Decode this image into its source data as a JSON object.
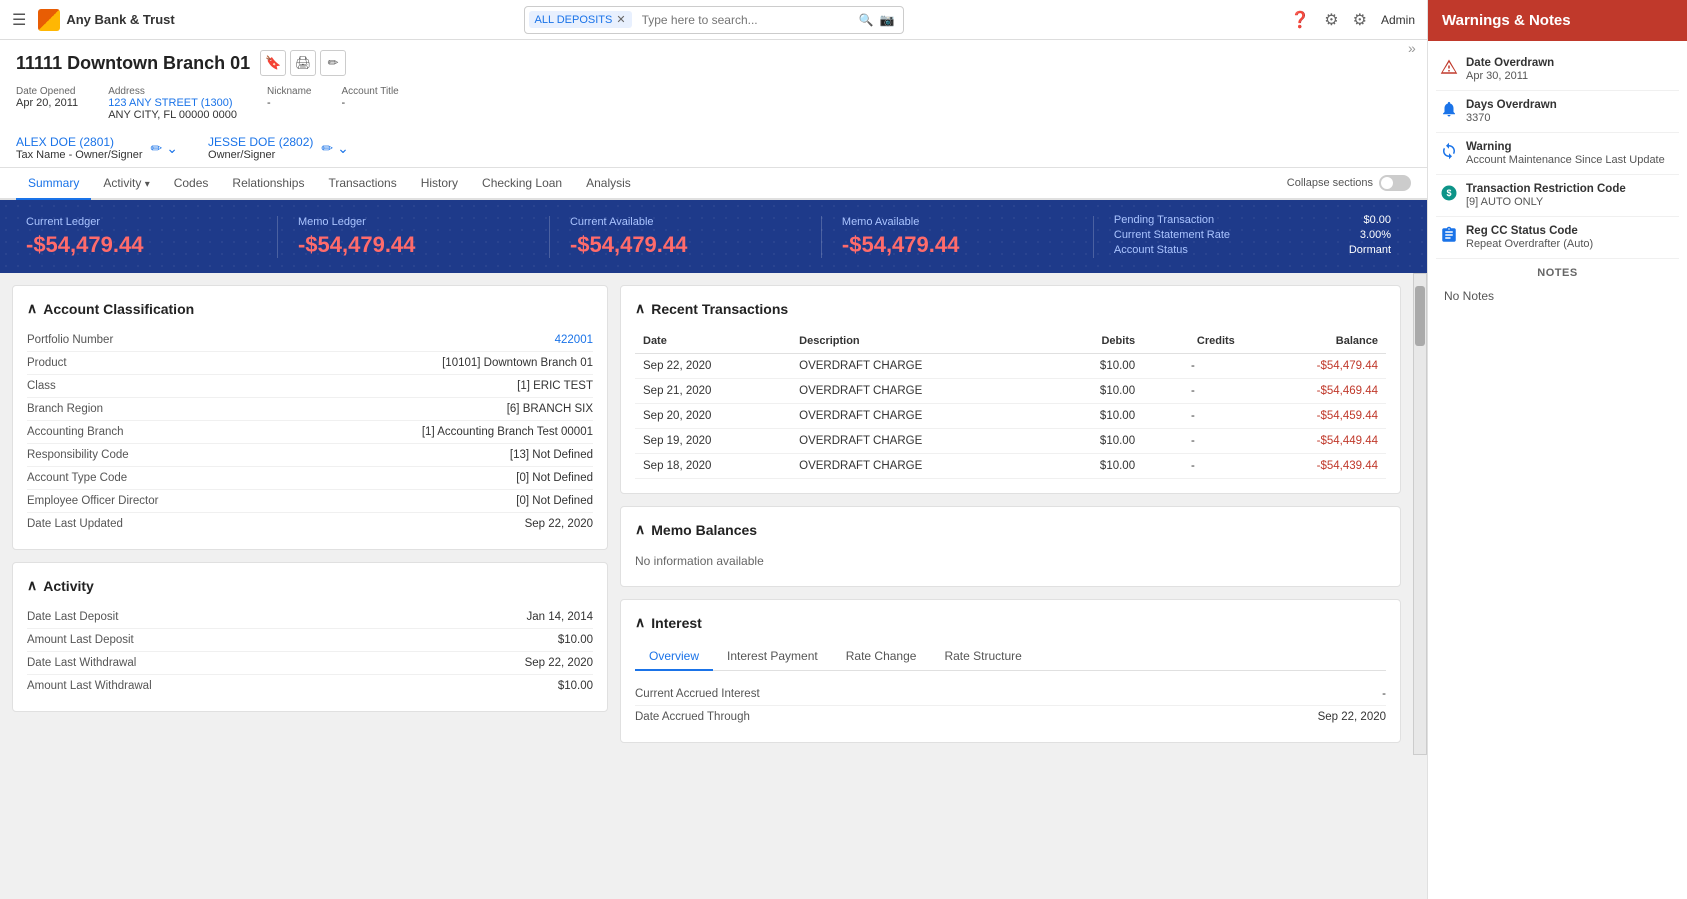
{
  "topNav": {
    "hamburger": "☰",
    "logoText": "Any Bank & Trust",
    "searchTag": "ALL DEPOSITS",
    "searchPlaceholder": "Type here to search...",
    "admin": "Admin"
  },
  "accountHeader": {
    "title": "11111 Downtown Branch 01",
    "icons": [
      "🔖",
      "🖨",
      "✏"
    ],
    "meta": {
      "dateOpened": {
        "label": "Date Opened",
        "value": "Apr 20, 2011"
      },
      "address": {
        "label": "Address",
        "line1": "123 ANY STREET (1300)",
        "line2": "ANY CITY, FL 00000 0000"
      },
      "nickname": {
        "label": "Nickname",
        "value": "-"
      },
      "accountTitle": {
        "label": "Account Title",
        "value": "-"
      }
    },
    "signers": [
      {
        "id": "2801",
        "name": "ALEX DOE",
        "role": "Tax Name - Owner/Signer"
      },
      {
        "id": "2802",
        "name": "JESSE DOE",
        "role": "Owner/Signer"
      }
    ]
  },
  "tabs": [
    "Summary",
    "Activity",
    "Codes",
    "Relationships",
    "Transactions",
    "History",
    "Checking Loan",
    "Analysis"
  ],
  "activeTab": "Summary",
  "collapseSections": "Collapse sections",
  "balanceBanner": {
    "currentLedger": {
      "label": "Current Ledger",
      "value": "-$54,479.44"
    },
    "memoLedger": {
      "label": "Memo Ledger",
      "value": "-$54,479.44"
    },
    "currentAvailable": {
      "label": "Current Available",
      "value": "-$54,479.44"
    },
    "memoAvailable": {
      "label": "Memo Available",
      "value": "-$54,479.44"
    },
    "extras": [
      {
        "label": "Pending Transaction",
        "value": "$0.00"
      },
      {
        "label": "Current Statement Rate",
        "value": "3.00%"
      },
      {
        "label": "Account Status",
        "value": "Dormant"
      }
    ]
  },
  "accountClassification": {
    "title": "Account Classification",
    "fields": [
      {
        "label": "Portfolio Number",
        "value": "422001",
        "link": true
      },
      {
        "label": "Product",
        "value": "[10101] Downtown Branch 01"
      },
      {
        "label": "Class",
        "value": "[1] ERIC TEST"
      },
      {
        "label": "Branch Region",
        "value": "[6] BRANCH SIX"
      },
      {
        "label": "Accounting Branch",
        "value": "[1] Accounting Branch Test 00001"
      },
      {
        "label": "Responsibility Code",
        "value": "[13] Not Defined"
      },
      {
        "label": "Account Type Code",
        "value": "[0] Not Defined"
      },
      {
        "label": "Employee Officer Director",
        "value": "[0] Not Defined"
      },
      {
        "label": "Date Last Updated",
        "value": "Sep 22, 2020"
      }
    ]
  },
  "activity": {
    "title": "Activity",
    "fields": [
      {
        "label": "Date Last Deposit",
        "value": "Jan 14, 2014"
      },
      {
        "label": "Amount Last Deposit",
        "value": "$10.00"
      },
      {
        "label": "Date Last Withdrawal",
        "value": "Sep 22, 2020"
      },
      {
        "label": "Amount Last Withdrawal",
        "value": "$10.00"
      }
    ]
  },
  "recentTransactions": {
    "title": "Recent Transactions",
    "columns": [
      "Date",
      "Description",
      "Debits",
      "Credits",
      "Balance"
    ],
    "rows": [
      {
        "date": "Sep 22, 2020",
        "desc": "OVERDRAFT CHARGE",
        "debits": "$10.00",
        "credits": "-",
        "balance": "-$54,479.44"
      },
      {
        "date": "Sep 21, 2020",
        "desc": "OVERDRAFT CHARGE",
        "debits": "$10.00",
        "credits": "-",
        "balance": "-$54,469.44"
      },
      {
        "date": "Sep 20, 2020",
        "desc": "OVERDRAFT CHARGE",
        "debits": "$10.00",
        "credits": "-",
        "balance": "-$54,459.44"
      },
      {
        "date": "Sep 19, 2020",
        "desc": "OVERDRAFT CHARGE",
        "debits": "$10.00",
        "credits": "-",
        "balance": "-$54,449.44"
      },
      {
        "date": "Sep 18, 2020",
        "desc": "OVERDRAFT CHARGE",
        "debits": "$10.00",
        "credits": "-",
        "balance": "-$54,439.44"
      }
    ]
  },
  "memoBalances": {
    "title": "Memo Balances",
    "noInfo": "No information available"
  },
  "interest": {
    "title": "Interest",
    "tabs": [
      "Overview",
      "Interest Payment",
      "Rate Change",
      "Rate Structure"
    ],
    "activeTab": "Overview",
    "fields": [
      {
        "label": "Current Accrued Interest",
        "value": "-"
      },
      {
        "label": "Date Accrued Through",
        "value": "Sep 22, 2020"
      }
    ]
  },
  "sidebar": {
    "title": "Warnings & Notes",
    "warnings": [
      {
        "icon": "⚠",
        "iconClass": "red",
        "title": "Date Overdrawn",
        "value": "Apr 30, 2011"
      },
      {
        "icon": "🔔",
        "iconClass": "blue",
        "title": "Days Overdrawn",
        "value": "3370"
      },
      {
        "icon": "↻",
        "iconClass": "blue",
        "title": "Warning",
        "value": "Account Maintenance Since Last Update"
      },
      {
        "icon": "$",
        "iconClass": "teal",
        "title": "Transaction Restriction Code",
        "value": "[9] AUTO ONLY"
      },
      {
        "icon": "📋",
        "iconClass": "blue",
        "title": "Reg CC Status Code",
        "value": "Repeat Overdrafter (Auto)"
      }
    ],
    "notesTitle": "NOTES",
    "noNotes": "No Notes"
  }
}
